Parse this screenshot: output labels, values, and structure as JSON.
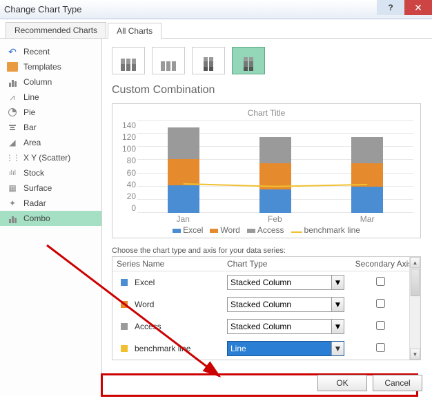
{
  "window": {
    "title": "Change Chart Type"
  },
  "tabs": {
    "recommended": "Recommended Charts",
    "all": "All Charts"
  },
  "sidebar": {
    "items": [
      {
        "label": "Recent"
      },
      {
        "label": "Templates"
      },
      {
        "label": "Column"
      },
      {
        "label": "Line"
      },
      {
        "label": "Pie"
      },
      {
        "label": "Bar"
      },
      {
        "label": "Area"
      },
      {
        "label": "X Y (Scatter)"
      },
      {
        "label": "Stock"
      },
      {
        "label": "Surface"
      },
      {
        "label": "Radar"
      },
      {
        "label": "Combo"
      }
    ]
  },
  "section": {
    "title": "Custom Combination"
  },
  "chart": {
    "title": "Chart Title",
    "xlabels": [
      "Jan",
      "Feb",
      "Mar"
    ],
    "legend": [
      "Excel",
      "Word",
      "Access",
      "benchmark line"
    ]
  },
  "chart_data": {
    "type": "bar",
    "categories": [
      "Jan",
      "Feb",
      "Mar"
    ],
    "series": [
      {
        "name": "Excel",
        "values": [
          42,
          36,
          40
        ],
        "color": "#4a8dd2"
      },
      {
        "name": "Word",
        "values": [
          40,
          39,
          35
        ],
        "color": "#e68a2e"
      },
      {
        "name": "Access",
        "values": [
          48,
          40,
          40
        ],
        "color": "#9a9a9a"
      },
      {
        "name": "benchmark line",
        "type": "line",
        "values": [
          44,
          40,
          43
        ],
        "color": "#f0c030"
      }
    ],
    "ylim": [
      0,
      140
    ],
    "ytick": 20,
    "title": "Chart Title"
  },
  "choose": {
    "label": "Choose the chart type and axis for your data series:",
    "headers": {
      "series": "Series Name",
      "type": "Chart Type",
      "axis": "Secondary Axis"
    },
    "rows": [
      {
        "name": "Excel",
        "color": "#4a8dd2",
        "type": "Stacked Column"
      },
      {
        "name": "Word",
        "color": "#e68a2e",
        "type": "Stacked Column"
      },
      {
        "name": "Access",
        "color": "#9a9a9a",
        "type": "Stacked Column"
      },
      {
        "name": "benchmark line",
        "color": "#f0c030",
        "type": "Line",
        "selected": true
      }
    ]
  },
  "buttons": {
    "ok": "OK",
    "cancel": "Cancel"
  }
}
